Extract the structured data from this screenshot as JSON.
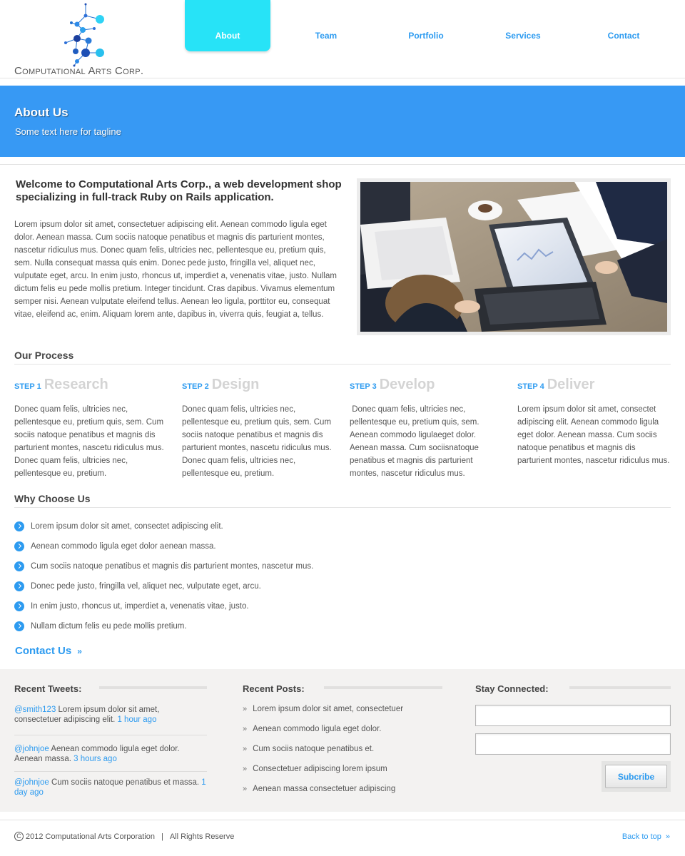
{
  "brand": {
    "name": "Computational Arts Corp.",
    "logo_icon": "molecule-network-icon"
  },
  "nav": {
    "items": [
      {
        "label": "About",
        "active": true
      },
      {
        "label": "Team",
        "active": false
      },
      {
        "label": "Portfolio",
        "active": false
      },
      {
        "label": "Services",
        "active": false
      },
      {
        "label": "Contact",
        "active": false
      }
    ]
  },
  "banner": {
    "title": "About Us",
    "tagline": "Some text here for tagline"
  },
  "welcome": {
    "title": "Welcome to Computational Arts Corp., a web development shop specializing in full-track Ruby on Rails application.",
    "body": "Lorem ipsum dolor sit amet, consectetuer adipiscing elit. Aenean commodo ligula eget dolor. Aenean massa. Cum sociis natoque penatibus et magnis dis parturient montes, nascetur ridiculus mus. Donec quam felis, ultricies nec, pellentesque eu, pretium quis, sem. Nulla consequat massa quis enim. Donec pede justo, fringilla vel, aliquet nec, vulputate eget, arcu. In enim justo, rhoncus ut, imperdiet a, venenatis vitae, justo. Nullam dictum felis eu pede mollis pretium. Integer tincidunt. Cras dapibus. Vivamus elementum semper nisi. Aenean vulputate eleifend tellus. Aenean leo ligula, porttitor eu, consequat vitae, eleifend ac, enim. Aliquam lorem ante, dapibus in, viverra quis, feugiat a, tellus."
  },
  "process": {
    "title": "Our Process",
    "steps": [
      {
        "label": "STEP 1",
        "name": "Research",
        "text": "Donec quam felis, ultricies nec, pellentesque eu, pretium quis, sem. Cum sociis natoque penatibus et magnis dis parturient montes, nascetu ridiculus mus. Donec quam felis, ultricies nec, pellentesque eu, pretium."
      },
      {
        "label": "STEP 2",
        "name": "Design",
        "text": "Donec quam felis, ultricies nec, pellentesque eu, pretium quis, sem. Cum sociis natoque penatibus et magnis dis parturient montes, nascetu ridiculus mus. Donec quam felis, ultricies nec, pellentesque eu, pretium."
      },
      {
        "label": "STEP 3",
        "name": "Develop",
        "text": " Donec quam felis, ultricies nec, pellentesque eu, pretium quis, sem. Aenean commodo ligulaeget dolor. Aenean massa. Cum sociisnatoque penatibus et magnis dis parturient montes, nascetur ridiculus mus."
      },
      {
        "label": "STEP 4",
        "name": "Deliver",
        "text": "Lorem ipsum dolor sit amet, consectet adipiscing elit. Aenean commodo ligula eget dolor. Aenean massa. Cum sociis natoque penatibus et magnis dis parturient montes, nascetur ridiculus mus."
      }
    ]
  },
  "why": {
    "title": "Why Choose Us",
    "items": [
      "Lorem ipsum dolor sit amet, consectet adipiscing elit.",
      "Aenean commodo ligula eget dolor aenean massa.",
      "Cum sociis natoque penatibus et magnis dis parturient montes, nascetur mus.",
      "Donec pede justo, fringilla vel, aliquet nec, vulputate eget, arcu.",
      "In enim justo, rhoncus ut, imperdiet a, venenatis vitae, justo.",
      "Nullam dictum felis eu pede mollis pretium."
    ]
  },
  "contact_link": {
    "label": "Contact Us",
    "chevron": "»"
  },
  "footer": {
    "tweets": {
      "title": "Recent Tweets:",
      "items": [
        {
          "handle": "@smith123",
          "text": " Lorem ipsum dolor sit amet, consectetuer adipiscing elit. ",
          "time": "1 hour ago"
        },
        {
          "handle": "@johnjoe",
          "text": " Aenean commodo ligula eget dolor. Aenean massa. ",
          "time": "3 hours ago"
        },
        {
          "handle": "@johnjoe",
          "text": " Cum sociis natoque penatibus et massa. ",
          "time": "1 day ago"
        }
      ]
    },
    "posts": {
      "title": "Recent Posts:",
      "arrow": "»",
      "items": [
        "Lorem ipsum dolor sit amet, consectetuer",
        "Aenean commodo ligula eget dolor.",
        "Cum sociis natoque penatibus et.",
        "Consectetuer adipiscing lorem ipsum",
        "Aenean massa consectetuer adipiscing"
      ]
    },
    "connect": {
      "title": "Stay Connected:",
      "submit_label": "Subcribe"
    }
  },
  "bottom": {
    "copyright_symbol": "C",
    "copyright": "2012 Computational Arts Corporation",
    "separator": "|",
    "rights": "All Rights Reserve",
    "back_to_top": "Back to top",
    "back_chevron": "»"
  }
}
